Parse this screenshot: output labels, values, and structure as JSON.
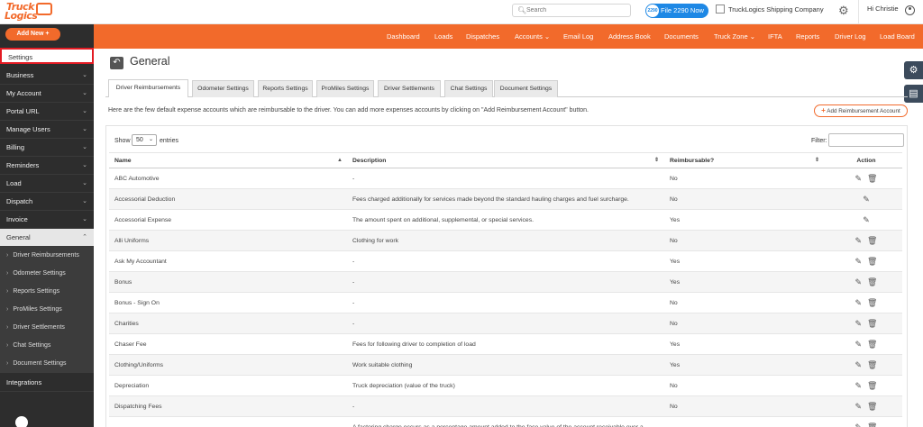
{
  "topbar": {
    "logo_line1": "Truck",
    "logo_line2": "Logics",
    "search_placeholder": "Search",
    "file_button": "File 2290 Now",
    "file_badge": "2290",
    "company": "TruckLogics Shipping Company",
    "greeting": "Hi Christie"
  },
  "sidebar": {
    "add_new": "Add New",
    "settings": "Settings",
    "items": [
      {
        "label": "Business"
      },
      {
        "label": "My Account"
      },
      {
        "label": "Portal URL"
      },
      {
        "label": "Manage Users"
      },
      {
        "label": "Billing"
      },
      {
        "label": "Reminders"
      },
      {
        "label": "Load"
      },
      {
        "label": "Dispatch"
      },
      {
        "label": "Invoice"
      }
    ],
    "general": "General",
    "sub_items": [
      {
        "label": "Driver Reimbursements"
      },
      {
        "label": "Odometer Settings"
      },
      {
        "label": "Reports Settings"
      },
      {
        "label": "ProMiles Settings"
      },
      {
        "label": "Driver Settlements"
      },
      {
        "label": "Chat Settings"
      },
      {
        "label": "Document Settings"
      }
    ],
    "integrations": "Integrations"
  },
  "nav": {
    "items": [
      {
        "label": "Dashboard"
      },
      {
        "label": "Loads"
      },
      {
        "label": "Dispatches"
      },
      {
        "label": "Accounts ⌄"
      },
      {
        "label": "Email Log"
      },
      {
        "label": "Address Book"
      },
      {
        "label": "Documents"
      },
      {
        "label": "Truck Zone ⌄"
      },
      {
        "label": "IFTA"
      },
      {
        "label": "Reports"
      },
      {
        "label": "Driver Log"
      },
      {
        "label": "Load Board"
      }
    ]
  },
  "page": {
    "title": "General",
    "tabs": [
      {
        "label": "Driver Reimbursements"
      },
      {
        "label": "Odometer Settings"
      },
      {
        "label": "Reports Settings"
      },
      {
        "label": "ProMiles Settings"
      },
      {
        "label": "Driver Settlements"
      },
      {
        "label": "Chat Settings"
      },
      {
        "label": "Document Settings"
      }
    ],
    "intro": "Here are the few default expense accounts which are reimbursable to the driver. You can add more expenses accounts by clicking on \"Add Reimbursement Account\" button.",
    "add_button": "Add Reimbursement Account"
  },
  "table": {
    "show_label": "Show",
    "page_size": "50",
    "entries_label": "entries",
    "filter_label": "Filter:",
    "columns": {
      "name": "Name",
      "description": "Description",
      "reimbursable": "Reimbursable?",
      "action": "Action"
    },
    "rows": [
      {
        "name": "ABC Automotive",
        "description": "-",
        "reimbursable": "No",
        "delete": true
      },
      {
        "name": "Accessorial Deduction",
        "description": "Fees charged additionally for services made beyond the standard hauling charges and fuel surcharge.",
        "reimbursable": "No",
        "delete": false
      },
      {
        "name": "Accessorial Expense",
        "description": "The amount spent on additional, supplemental, or special services.",
        "reimbursable": "Yes",
        "delete": false
      },
      {
        "name": "Alli Uniforms",
        "description": "Clothing for work",
        "reimbursable": "No",
        "delete": true
      },
      {
        "name": "Ask My Accountant",
        "description": "-",
        "reimbursable": "Yes",
        "delete": true
      },
      {
        "name": "Bonus",
        "description": "-",
        "reimbursable": "Yes",
        "delete": true
      },
      {
        "name": "Bonus - Sign On",
        "description": "-",
        "reimbursable": "No",
        "delete": true
      },
      {
        "name": "Charities",
        "description": "-",
        "reimbursable": "No",
        "delete": true
      },
      {
        "name": "Chaser Fee",
        "description": "Fees for following driver to completion of load",
        "reimbursable": "Yes",
        "delete": true
      },
      {
        "name": "Clothing/Uniforms",
        "description": "Work suitable clothing",
        "reimbursable": "Yes",
        "delete": true
      },
      {
        "name": "Depreciation",
        "description": "Truck depreciation (value of the truck)",
        "reimbursable": "No",
        "delete": true
      },
      {
        "name": "Dispatching Fees",
        "description": "-",
        "reimbursable": "No",
        "delete": true
      },
      {
        "name": "",
        "description": "A factoring charge occurs as a percentage amount added to the face value of the account receivable over a",
        "reimbursable": "",
        "delete": true
      }
    ]
  },
  "colors": {
    "accent": "#f26a2b",
    "sidebar": "#2d2d2d",
    "blue": "#1e88e5",
    "highlight": "#e31b23"
  }
}
